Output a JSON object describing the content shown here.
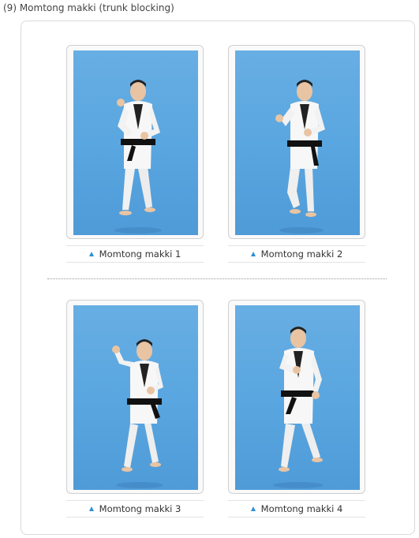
{
  "page": {
    "title": "(9) Momtong makki (trunk blocking)"
  },
  "photos": [
    {
      "caption": "Momtong makki 1"
    },
    {
      "caption": "Momtong makki 2"
    },
    {
      "caption": "Momtong makki 3"
    },
    {
      "caption": "Momtong makki 4"
    }
  ],
  "colors": {
    "accent": "#2a8fd6",
    "photo_bg": "#5aa6e0",
    "uniform": "#f4f4f4",
    "belt": "#111111"
  },
  "icons": {
    "caption_marker": "triangle-up-icon"
  }
}
